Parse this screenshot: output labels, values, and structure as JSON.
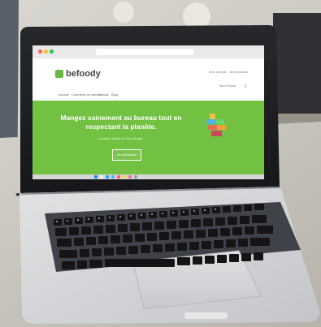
{
  "browser": {
    "tab_title": "",
    "url_text": ""
  },
  "site": {
    "logo_text": "befoody",
    "header_links": [
      "Mon compte",
      "Se connecter"
    ],
    "nav_links": [
      "Accueil",
      "Comment ça marche",
      "Contact",
      "Blog"
    ],
    "cart_label": "Mon Panier"
  },
  "hero": {
    "title": "Mangez sainement au bureau tout en respectant la planète.",
    "subtitle": "Livraison rapide et zéro déchet",
    "button_label": "Je commande"
  },
  "colors": {
    "brand_green": "#72c142",
    "logo_green": "#68b941",
    "laptop_silver": "#c9ccd0"
  },
  "icons": {
    "dock": [
      "finder-icon",
      "launchpad-icon",
      "safari-icon",
      "mail-icon",
      "calendar-icon",
      "photos-icon",
      "music-icon",
      "settings-icon",
      "trash-icon"
    ]
  }
}
